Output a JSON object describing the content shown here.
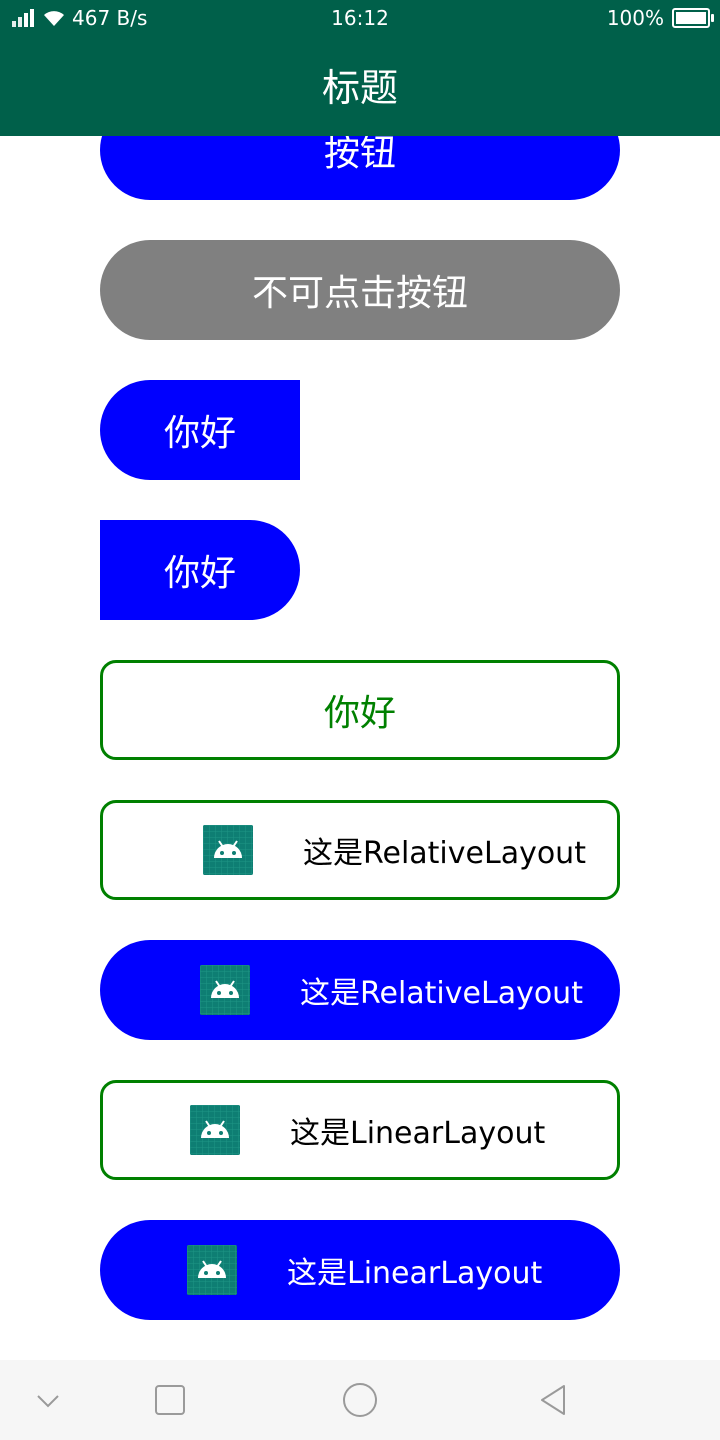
{
  "status_bar": {
    "signal_label": "ˣıl",
    "network_speed": "467 B/s",
    "time": "16:12",
    "battery_percent": "100%"
  },
  "app_bar": {
    "title": "标题"
  },
  "buttons": {
    "top_partial": "按钮",
    "disabled": "不可点击按钮",
    "left_rounded": "你好",
    "right_rounded": "你好",
    "outlined": "你好",
    "relative_outline": "这是RelativeLayout",
    "relative_blue": "这是RelativeLayout",
    "linear_outline": "这是LinearLayout",
    "linear_blue": "这是LinearLayout"
  },
  "icons": {
    "signal": "signal-icon",
    "wifi": "wifi-icon",
    "battery": "battery-icon",
    "android": "android-icon",
    "nav_down": "chevron-down-icon",
    "nav_recents": "square-icon",
    "nav_home": "circle-icon",
    "nav_back": "triangle-back-icon"
  },
  "colors": {
    "appbar": "#00604a",
    "primary_blue": "#0000ff",
    "disabled_grey": "#808080",
    "outline_green": "#008000",
    "icon_teal": "#0e7e73"
  }
}
